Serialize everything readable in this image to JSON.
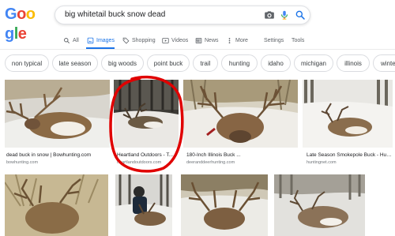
{
  "logo": {
    "letters": [
      "G",
      "o",
      "o",
      "g",
      "l",
      "e"
    ],
    "colors": [
      "#4285f4",
      "#ea4335",
      "#fbbc05",
      "#4285f4",
      "#34a853",
      "#ea4335"
    ]
  },
  "search": {
    "query": "big whitetail buck snow dead"
  },
  "tabs": [
    {
      "label": "All",
      "icon": "search-icon"
    },
    {
      "label": "Images",
      "icon": "image-icon",
      "active": true
    },
    {
      "label": "Shopping",
      "icon": "tag-icon"
    },
    {
      "label": "Videos",
      "icon": "play-icon"
    },
    {
      "label": "News",
      "icon": "newspaper-icon"
    },
    {
      "label": "More",
      "icon": "more-dots-icon"
    }
  ],
  "tools": {
    "settings": "Settings",
    "tools": "Tools"
  },
  "chips": [
    "non typical",
    "late season",
    "big woods",
    "point buck",
    "trail",
    "hunting",
    "idaho",
    "michigan",
    "illinois",
    "winte"
  ],
  "results": [
    {
      "title": "dead buck in snow | Bowhunting.com",
      "source": "bowhunting.com"
    },
    {
      "title": "Heartland Outdoors - T...",
      "source": "heartlandoutdoors.com"
    },
    {
      "title": "180-Inch Illinois Buck ...",
      "source": "deeranddeerhunting.com"
    },
    {
      "title": "Late Season Smokepole Buck - Hunti...",
      "source": "huntingnet.com"
    }
  ],
  "colors": {
    "accent": "#1a73e8",
    "annotation": "#e00000"
  }
}
